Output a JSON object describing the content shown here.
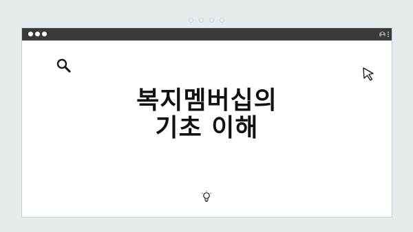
{
  "headline": {
    "line1": "복지멤버십의",
    "line2": "기초 이해"
  },
  "icons": {
    "search": "search-icon",
    "cursor": "cursor-icon",
    "bulb": "lightbulb-icon",
    "profile": "profile-icon",
    "menu": "kebab-menu-icon"
  },
  "colors": {
    "background": "#e6ebee",
    "title_bar": "#3a3a3a",
    "window": "#ffffff",
    "text": "#111111"
  }
}
